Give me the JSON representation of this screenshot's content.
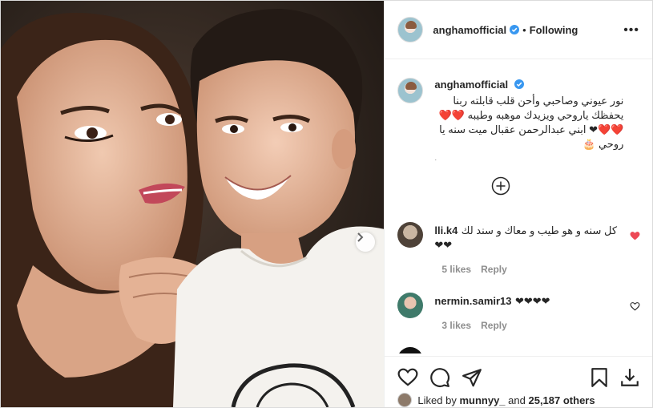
{
  "post": {
    "username": "anghamofficial",
    "separator": "•",
    "follow_status": "Following",
    "more_label": "•••"
  },
  "caption": {
    "username": "anghamofficial",
    "text": "نور عيوني وصاحبي وأحن قلب قابلته ربنا يحفظك ياروحي ويزيدك موهبه وطيبه ❤️❤️❤️❤️❤ ابني عبدالرحمن عقبال ميت سنه يا روحي 🎂",
    "dot": "."
  },
  "comments": [
    {
      "username": "lli.k4",
      "text": "كل سنه و هو طيب و معاك و سند لك ❤❤",
      "likes": "5 likes",
      "reply": "Reply",
      "liked": true
    },
    {
      "username": "nermin.samir13",
      "text": "❤❤❤❤",
      "likes": "3 likes",
      "reply": "Reply",
      "liked": false
    }
  ],
  "footer": {
    "liked_by_prefix": "Liked by",
    "liked_by_user": "munnyy_",
    "and_text": "and",
    "others_count": "25,187 others"
  },
  "colors": {
    "liked_heart": "#ed4956",
    "verified": "#3897f0",
    "meta": "#8e8e8e"
  }
}
